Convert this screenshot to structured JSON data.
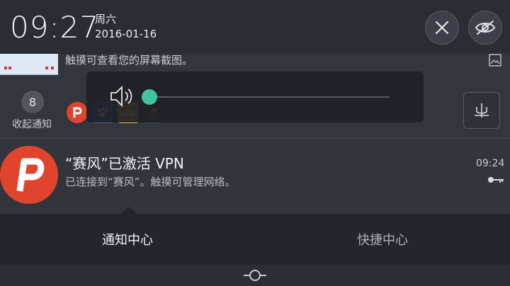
{
  "status": {
    "time": "09:27",
    "weekday": "周六",
    "date": "2016-01-16"
  },
  "screenshot_notification": {
    "text": "触摸可查看您的屏幕截图。"
  },
  "collapse": {
    "count": "8",
    "label": "收起通知"
  },
  "volume": {
    "level": 0.0
  },
  "vpn_notification": {
    "title": "“赛风”已激活 VPN",
    "subtitle": "已连接到“赛风”。触摸可管理网络。",
    "time": "09:24"
  },
  "tabs": {
    "notifications": "通知中心",
    "shortcuts": "快捷中心"
  },
  "colors": {
    "accent": "#3fc3a0",
    "vpn_brand": "#e0442d"
  }
}
